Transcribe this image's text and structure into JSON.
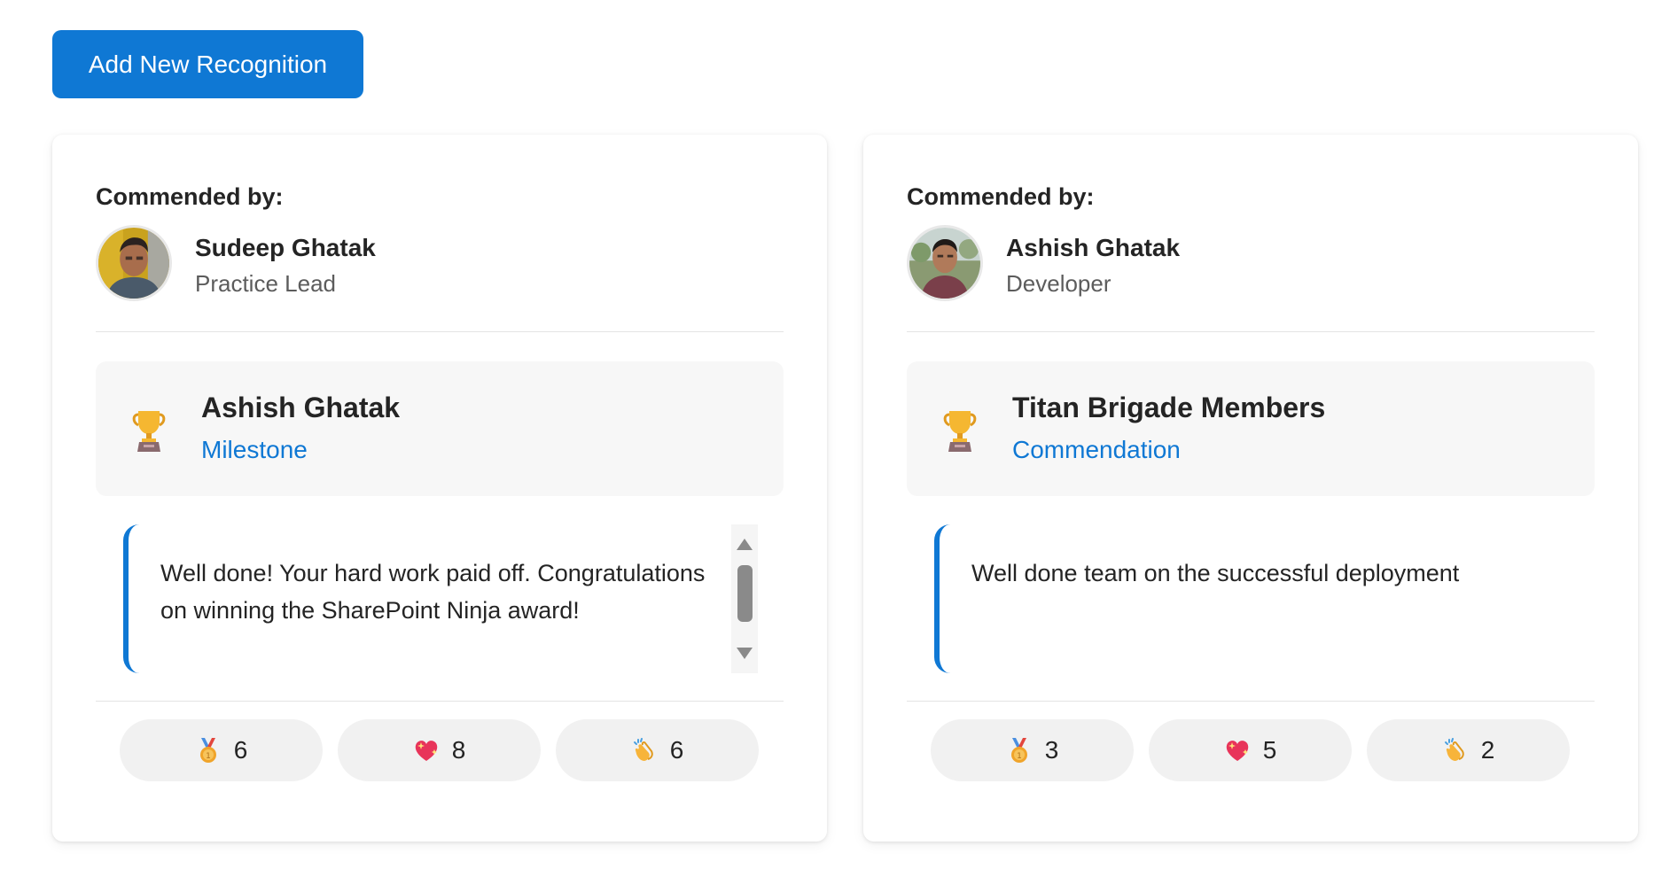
{
  "add_button_label": "Add New Recognition",
  "colors": {
    "accent": "#0f78d4",
    "card_bg": "#ffffff",
    "panel_bg": "#f7f7f7",
    "pill_bg": "#f1f1f1"
  },
  "cards": [
    {
      "commended_label": "Commended by:",
      "giver": {
        "name": "Sudeep Ghatak",
        "role": "Practice Lead",
        "avatar_icon": "avatar-photo"
      },
      "recipient": {
        "name": "Ashish Ghatak",
        "award_type": "Milestone",
        "icon": "trophy-icon"
      },
      "message": "Well done! Your hard work paid off. Congratulations on winning the SharePoint Ninja award!",
      "reactions": [
        {
          "icon": "medal-icon",
          "count": "6"
        },
        {
          "icon": "heart-icon",
          "count": "8"
        },
        {
          "icon": "clap-icon",
          "count": "6"
        }
      ]
    },
    {
      "commended_label": "Commended by:",
      "giver": {
        "name": "Ashish Ghatak",
        "role": "Developer",
        "avatar_icon": "avatar-photo"
      },
      "recipient": {
        "name": "Titan Brigade Members",
        "award_type": "Commendation",
        "icon": "trophy-icon"
      },
      "message": "Well done team on the successful deployment",
      "reactions": [
        {
          "icon": "medal-icon",
          "count": "3"
        },
        {
          "icon": "heart-icon",
          "count": "5"
        },
        {
          "icon": "clap-icon",
          "count": "2"
        }
      ]
    }
  ]
}
